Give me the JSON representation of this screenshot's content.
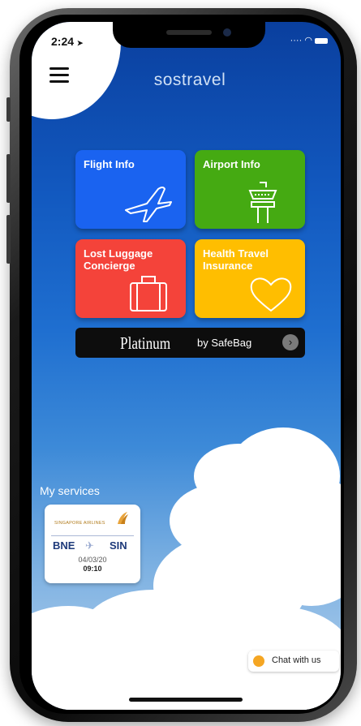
{
  "status_bar": {
    "time": "2:24"
  },
  "header": {
    "logo": "sostravel"
  },
  "tiles": [
    {
      "label": "Flight Info",
      "color": "#1a63f0",
      "icon": "airplane-icon"
    },
    {
      "label": "Airport Info",
      "color": "#45aa12",
      "icon": "control-tower-icon"
    },
    {
      "label": "Lost Luggage Concierge",
      "color": "#f4433a",
      "icon": "suitcase-icon"
    },
    {
      "label": "Health Travel Insurance",
      "color": "#ffbe00",
      "icon": "heart-icon"
    }
  ],
  "platinum_banner": {
    "title": "Platinum",
    "subtitle": "by SafeBag",
    "icon": "chevron-right-circle-icon"
  },
  "services": {
    "heading": "My services",
    "cards": [
      {
        "airline": "SINGAPORE AIRLINES",
        "origin": "BNE",
        "destination": "SIN",
        "date": "04/03/20",
        "time": "09:10"
      }
    ]
  },
  "chat": {
    "label": "Chat with us"
  },
  "colors": {
    "sky_top": "#0a3f9e",
    "sky_bottom": "#b9d4ee",
    "accent_orange": "#f5a623"
  }
}
